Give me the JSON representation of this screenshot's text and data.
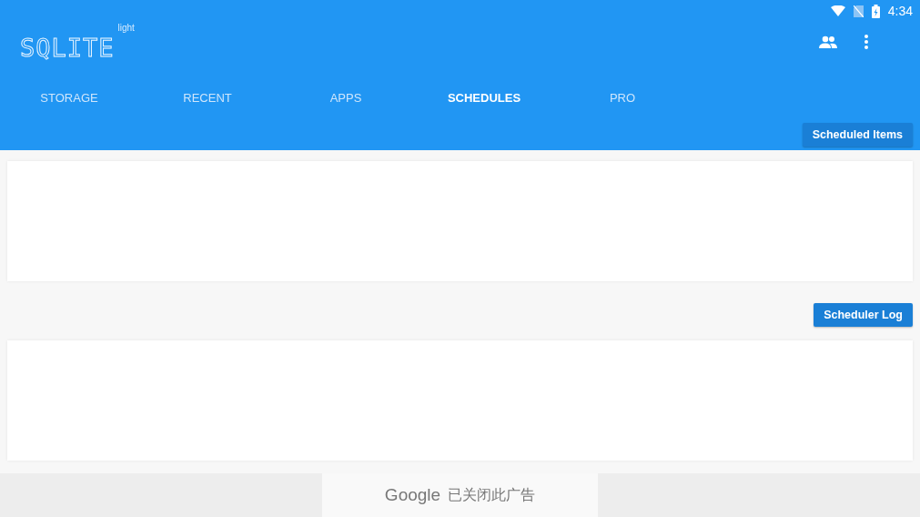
{
  "status_bar": {
    "time": "4:34"
  },
  "app_bar": {
    "logo": "SQLITE",
    "logo_badge": "light"
  },
  "tabs": [
    {
      "label": "STORAGE",
      "selected": false
    },
    {
      "label": "RECENT",
      "selected": false
    },
    {
      "label": "APPS",
      "selected": false
    },
    {
      "label": "SCHEDULES",
      "selected": true
    },
    {
      "label": "PRO",
      "selected": false
    }
  ],
  "sections": [
    {
      "button": "Scheduled Items"
    },
    {
      "button": "Scheduler Log"
    }
  ],
  "ad_banner": {
    "brand": "Google",
    "message": "已关闭此广告"
  }
}
